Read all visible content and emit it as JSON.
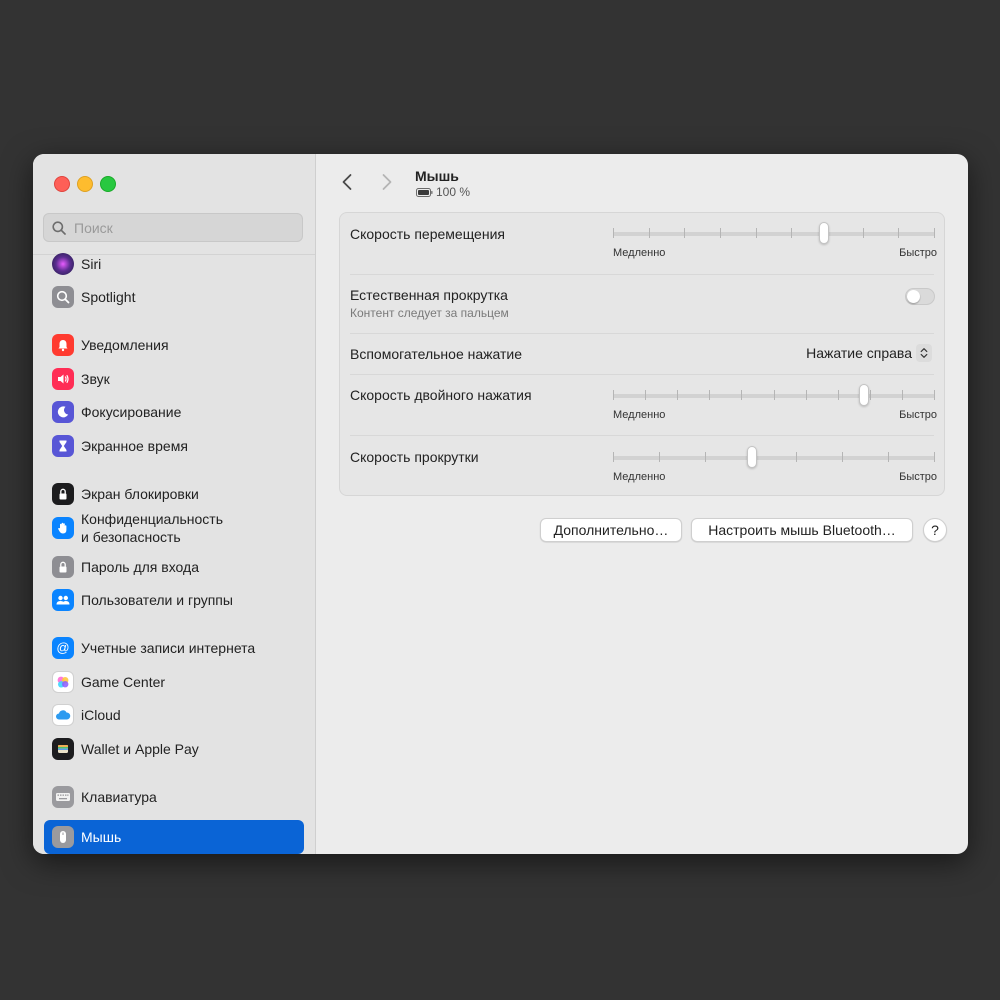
{
  "sidebar": {
    "search_placeholder": "Поиск",
    "items": [
      {
        "label": "Siri",
        "icon": "siri-icon",
        "color": "#5b2d90"
      },
      {
        "label": "Spotlight",
        "icon": "spotlight-icon",
        "color": "#8e8e93"
      },
      {
        "label": "Уведомления",
        "icon": "notifications-icon",
        "color": "#ff3b30"
      },
      {
        "label": "Звук",
        "icon": "sound-icon",
        "color": "#ff2d55"
      },
      {
        "label": "Фокусирование",
        "icon": "focus-icon",
        "color": "#5856d6"
      },
      {
        "label": "Экранное время",
        "icon": "screen-time-icon",
        "color": "#5856d6"
      },
      {
        "label": "Экран блокировки",
        "icon": "lock-screen-icon",
        "color": "#1c1c1e"
      },
      {
        "label": "Конфиденциальность",
        "label2": "и безопасность",
        "icon": "privacy-icon",
        "color": "#0a84ff"
      },
      {
        "label": "Пароль для входа",
        "icon": "password-icon",
        "color": "#8e8e93"
      },
      {
        "label": "Пользователи и группы",
        "icon": "users-icon",
        "color": "#0a84ff"
      },
      {
        "label": "Учетные записи интернета",
        "icon": "internet-accounts-icon",
        "color": "#0a84ff"
      },
      {
        "label": "Game Center",
        "icon": "game-center-icon",
        "color": "#ffffff"
      },
      {
        "label": "iCloud",
        "icon": "icloud-icon",
        "color": "#ffffff"
      },
      {
        "label": "Wallet и Apple Pay",
        "icon": "wallet-icon",
        "color": "#1c1c1e"
      },
      {
        "label": "Клавиатура",
        "icon": "keyboard-icon",
        "color": "#8e8e93"
      },
      {
        "label": "Мышь",
        "icon": "mouse-icon",
        "color": "#8e8e93",
        "selected": true
      }
    ]
  },
  "header": {
    "title": "Мышь",
    "battery_text": "100 %",
    "battery_level": 1.0
  },
  "settings": {
    "tracking_speed": {
      "label": "Скорость перемещения",
      "min": "Медленно",
      "max": "Быстро",
      "ticks": 10,
      "value": 0.66
    },
    "natural_scroll": {
      "label": "Естественная прокрутка",
      "sublabel": "Контент следует за пальцем",
      "on": false
    },
    "secondary_click": {
      "label": "Вспомогательное нажатие",
      "value": "Нажатие справа"
    },
    "double_click_speed": {
      "label": "Скорость двойного нажатия",
      "min": "Медленно",
      "max": "Быстро",
      "ticks": 11,
      "value": 0.79
    },
    "scroll_speed": {
      "label": "Скорость прокрутки",
      "min": "Медленно",
      "max": "Быстро",
      "ticks": 8,
      "value": 0.43
    }
  },
  "buttons": {
    "advanced": "Дополнительно…",
    "bluetooth": "Настроить мышь Bluetooth…",
    "help": "?"
  },
  "colors": {
    "accent": "#0a64d6",
    "desktop": "#333333"
  }
}
